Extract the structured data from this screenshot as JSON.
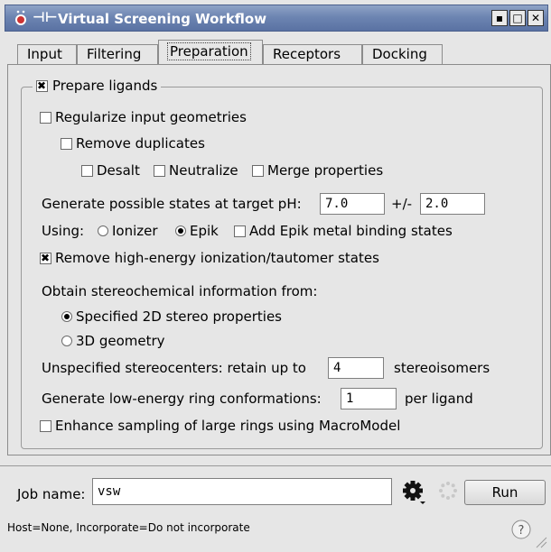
{
  "window": {
    "title": "Virtual Screening Workflow"
  },
  "tabs": [
    {
      "label": "Input"
    },
    {
      "label": "Filtering"
    },
    {
      "label": "Preparation"
    },
    {
      "label": "Receptors"
    },
    {
      "label": "Docking"
    }
  ],
  "active_tab": "Preparation",
  "prep": {
    "prepare_ligands": {
      "label": "Prepare ligands",
      "checked": true
    },
    "regularize": {
      "label": "Regularize input geometries",
      "checked": false
    },
    "remove_duplicates": {
      "label": "Remove duplicates",
      "checked": false
    },
    "desalt": {
      "label": "Desalt",
      "checked": false
    },
    "neutralize": {
      "label": "Neutralize",
      "checked": false
    },
    "merge_properties": {
      "label": "Merge properties",
      "checked": false
    },
    "ph_label": "Generate possible states at target pH:",
    "ph_value": "7.0",
    "ph_plusminus_label": "+/-",
    "ph_range": "2.0",
    "using_label": "Using:",
    "ionizer": {
      "label": "Ionizer",
      "selected": false
    },
    "epik": {
      "label": "Epik",
      "selected": true
    },
    "epik_metal": {
      "label": "Add Epik metal binding states",
      "checked": false
    },
    "remove_high_energy": {
      "label": "Remove high-energy ionization/tautomer states",
      "checked": true
    },
    "stereo_label": "Obtain stereochemical information from:",
    "stereo_2d": {
      "label": "Specified 2D stereo properties",
      "selected": true
    },
    "stereo_3d": {
      "label": "3D geometry",
      "selected": false
    },
    "unspecified_label": "Unspecified stereocenters: retain up to",
    "unspecified_value": "4",
    "unspecified_suffix": "stereoisomers",
    "ring_label": "Generate low-energy ring conformations:",
    "ring_value": "1",
    "ring_suffix": "per ligand",
    "macromodel": {
      "label": "Enhance sampling of large rings using MacroModel",
      "checked": false
    }
  },
  "footer": {
    "job_name_label": "Job name:",
    "job_name_value": "vsw",
    "run_label": "Run",
    "status": "Host=None, Incorporate=Do not incorporate",
    "help_label": "?"
  },
  "icons": {
    "settings": "gear-icon",
    "progress": "spinner-icon",
    "help": "help-icon",
    "app": "schrodinger-logo-icon",
    "pin": "pin-icon"
  }
}
